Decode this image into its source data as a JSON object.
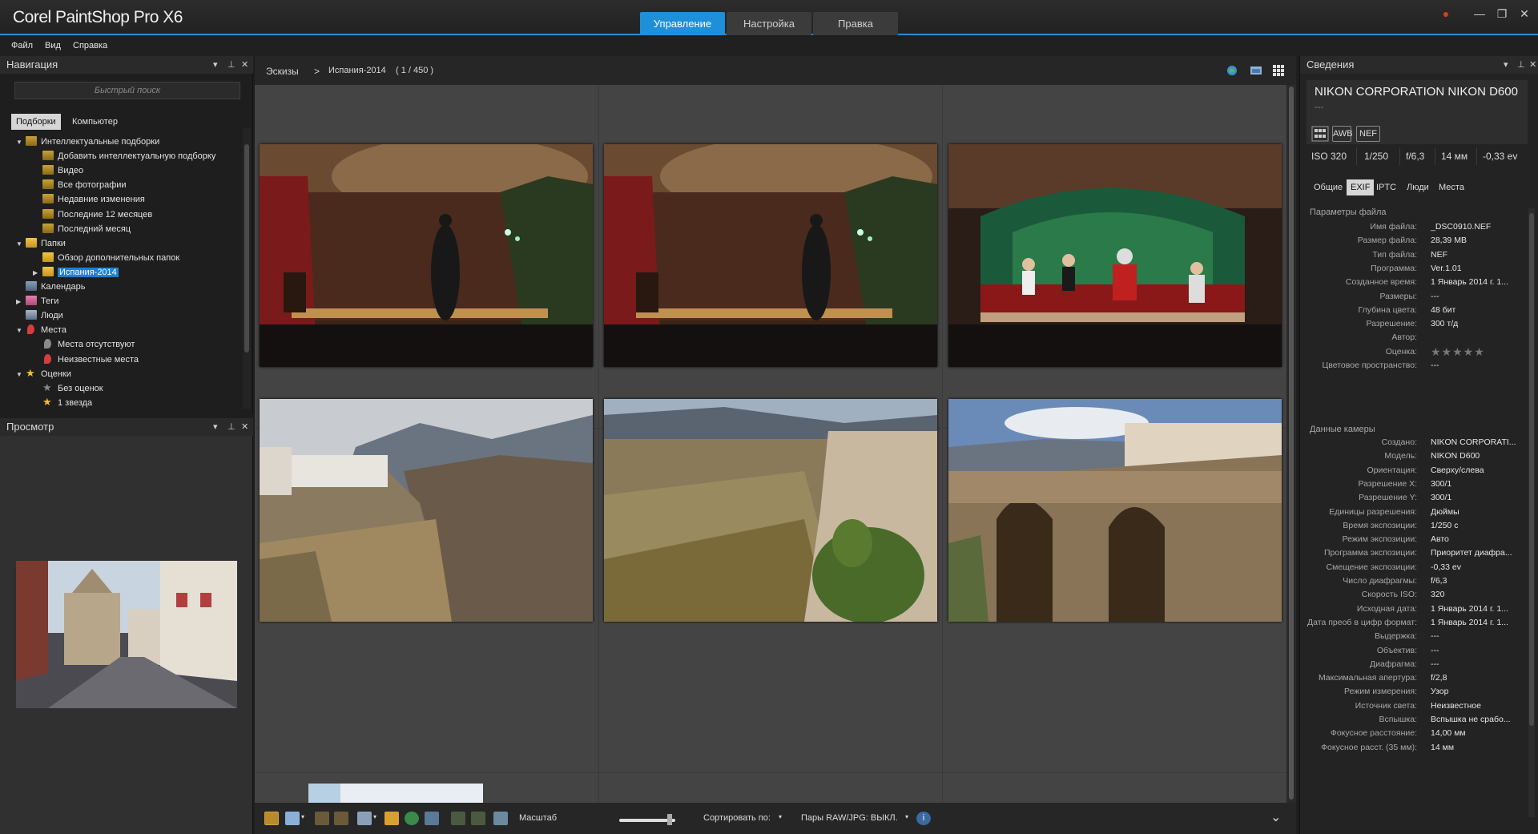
{
  "app": {
    "title": "Corel PaintShop Pro X6",
    "modes": [
      "Управление",
      "Настройка",
      "Правка"
    ],
    "window_controls": {
      "user": "●",
      "minimize": "—",
      "restore": "❐",
      "close": "✕"
    }
  },
  "menu": [
    "Файл",
    "Вид",
    "Справка"
  ],
  "navigation": {
    "title": "Навигация",
    "search_placeholder": "Быстрый поиск",
    "tabs": [
      "Подборки",
      "Компьютер"
    ],
    "tree": [
      {
        "label": "Интеллектуальные подборки",
        "level": 0,
        "arrow": "▼",
        "icon": "smart"
      },
      {
        "label": "Добавить интеллектуальную подборку",
        "level": 1,
        "arrow": "",
        "icon": "smart"
      },
      {
        "label": "Видео",
        "level": 1,
        "arrow": "",
        "icon": "smart"
      },
      {
        "label": "Все фотографии",
        "level": 1,
        "arrow": "",
        "icon": "smart"
      },
      {
        "label": "Недавние изменения",
        "level": 1,
        "arrow": "",
        "icon": "smart"
      },
      {
        "label": "Последние 12 месяцев",
        "level": 1,
        "arrow": "",
        "icon": "smart"
      },
      {
        "label": "Последний месяц",
        "level": 1,
        "arrow": "",
        "icon": "smart"
      },
      {
        "label": "Папки",
        "level": 0,
        "arrow": "▼",
        "icon": "folder"
      },
      {
        "label": "Обзор дополнительных папок",
        "level": 1,
        "arrow": "",
        "icon": "folder"
      },
      {
        "label": "Испания-2014",
        "level": 1,
        "arrow": "▶",
        "icon": "folder",
        "selected": true
      },
      {
        "label": "Календарь",
        "level": 0,
        "arrow": "",
        "icon": "cal"
      },
      {
        "label": "Теги",
        "level": 0,
        "arrow": "▶",
        "icon": "tag"
      },
      {
        "label": "Люди",
        "level": 0,
        "arrow": "",
        "icon": "people"
      },
      {
        "label": "Места",
        "level": 0,
        "arrow": "▼",
        "icon": "place"
      },
      {
        "label": "Места отсутствуют",
        "level": 1,
        "arrow": "",
        "icon": "place-grey"
      },
      {
        "label": "Неизвестные места",
        "level": 1,
        "arrow": "",
        "icon": "place"
      },
      {
        "label": "Оценки",
        "level": 0,
        "arrow": "▼",
        "icon": "star"
      },
      {
        "label": "Без оценок",
        "level": 1,
        "arrow": "",
        "icon": "star-grey"
      },
      {
        "label": "1 звезда",
        "level": 1,
        "arrow": "",
        "icon": "star"
      }
    ]
  },
  "preview": {
    "title": "Просмотр"
  },
  "breadcrumb": {
    "root": "Эскизы",
    "separator": ">",
    "folder": "Испания-2014",
    "count": "( 1 / 450 )"
  },
  "toolbar": {
    "zoom_label": "Масштаб",
    "zoom_level": 0.85,
    "sort_label": "Сортировать по:",
    "raw_pairs": "Пары RAW/JPG: ВЫКЛ."
  },
  "info": {
    "title": "Сведения",
    "camera": "NIKON CORPORATION NIKON D600",
    "camera_sub": "---",
    "badges": [
      "AWB",
      "NEF"
    ],
    "shot": [
      "ISO 320",
      "1/250",
      "f/6,3",
      "14 мм",
      "-0,33 ev"
    ],
    "tabs": [
      "Общие",
      "EXIF",
      "IPTC",
      "Люди",
      "Места"
    ],
    "file_section": "Параметры файла",
    "file_params": [
      {
        "label": "Имя файла:",
        "value": "_DSC0910.NEF"
      },
      {
        "label": "Размер файла:",
        "value": "28,39 МВ"
      },
      {
        "label": "Тип файла:",
        "value": "NEF"
      },
      {
        "label": "Программа:",
        "value": "Ver.1.01"
      },
      {
        "label": "Созданное время:",
        "value": "1 Январь 2014 г. 1..."
      },
      {
        "label": "Размеры:",
        "value": "---"
      },
      {
        "label": "Глубина цвета:",
        "value": "48 бит"
      },
      {
        "label": "Разрешение:",
        "value": "300 т/д"
      },
      {
        "label": "Автор:",
        "value": ""
      },
      {
        "label": "Оценка:",
        "value": "★★★★★"
      },
      {
        "label": "Цветовое пространство:",
        "value": "---"
      }
    ],
    "camera_section": "Данные камеры",
    "camera_params": [
      {
        "label": "Создано:",
        "value": "NIKON CORPORATI..."
      },
      {
        "label": "Модель:",
        "value": "NIKON D600"
      },
      {
        "label": "Ориентация:",
        "value": "Сверху/слева"
      },
      {
        "label": "Разрешение X:",
        "value": "300/1"
      },
      {
        "label": "Разрешение Y:",
        "value": "300/1"
      },
      {
        "label": "Единицы разрешения:",
        "value": "Дюймы"
      },
      {
        "label": "Время экспозиции:",
        "value": "1/250 с"
      },
      {
        "label": "Режим экспозиции:",
        "value": "Авто"
      },
      {
        "label": "Программа экспозиции:",
        "value": "Приоритет диафра..."
      },
      {
        "label": "Смещение экспозиции:",
        "value": "-0,33 ev"
      },
      {
        "label": "Число диафрагмы:",
        "value": "f/6,3"
      },
      {
        "label": "Скорость ISO:",
        "value": "320"
      },
      {
        "label": "Исходная дата:",
        "value": "1 Январь 2014 г. 1..."
      },
      {
        "label": "Дата преоб в цифр формат:",
        "value": "1 Январь 2014 г. 1..."
      },
      {
        "label": "Выдержка:",
        "value": "---"
      },
      {
        "label": "Объектив:",
        "value": "---"
      },
      {
        "label": "Диафрагма:",
        "value": "---"
      },
      {
        "label": "Максимальная апертура:",
        "value": "f/2,8"
      },
      {
        "label": "Режим измерения:",
        "value": "Узор"
      },
      {
        "label": "Источник света:",
        "value": "Неизвестное"
      },
      {
        "label": "Вспышка:",
        "value": "Вспышка не срабо..."
      },
      {
        "label": "Фокусное расстояние:",
        "value": "14,00 мм"
      },
      {
        "label": "Фокусное расст. (35 мм):",
        "value": "14 мм"
      }
    ]
  }
}
